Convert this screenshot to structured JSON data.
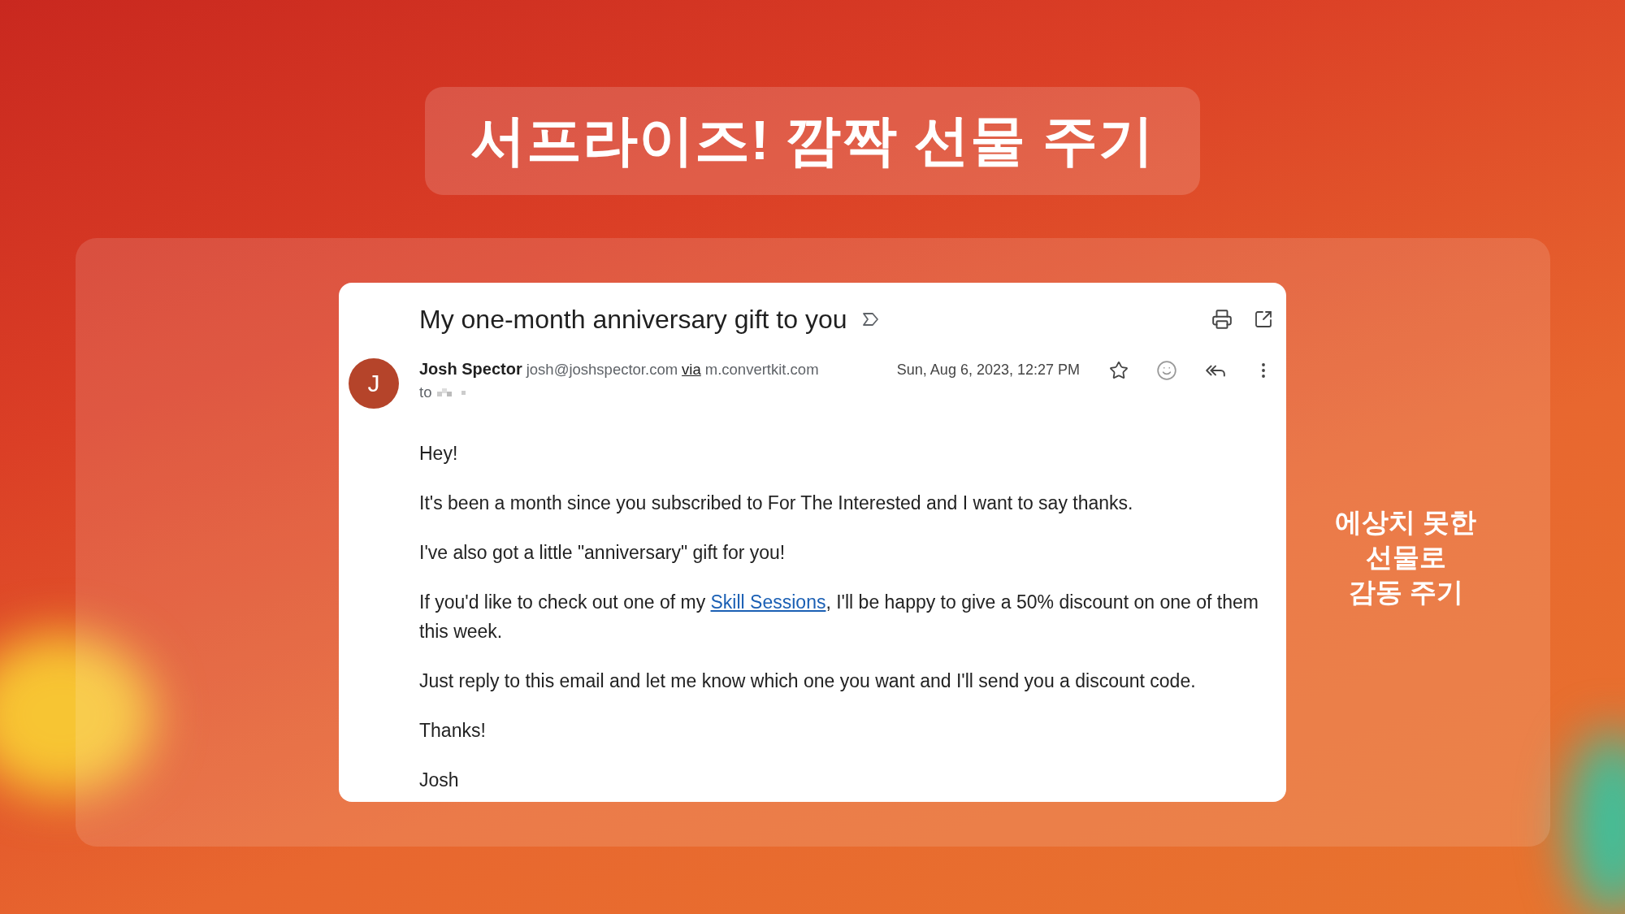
{
  "headline": "서프라이즈! 깜짝 선물 주기",
  "email": {
    "subject": "My one-month anniversary gift to you",
    "sender": {
      "initial": "J",
      "name": "Josh Spector",
      "address": "josh@joshspector.com",
      "via": "via",
      "domain": "m.convertkit.com",
      "to": "to"
    },
    "date": "Sun, Aug 6, 2023, 12:27 PM",
    "starred": false,
    "body": [
      {
        "text": "Hey!"
      },
      {
        "text": "It's been a month since you subscribed to For The Interested and I want to say thanks."
      },
      {
        "text": "I've also got a little \"anniversary\" gift for you!"
      },
      {
        "text": "If you'd like to check out one of my ",
        "link": "Skill Sessions",
        "after": ", I'll be happy to give a 50% discount on one of them this week."
      },
      {
        "text": "Just reply to this email and let me know which one you want and I'll send you a discount code."
      },
      {
        "text": "Thanks!"
      },
      {
        "text": "Josh"
      }
    ]
  },
  "caption": [
    "에상치 못한",
    "선물로",
    "감동 주기"
  ]
}
